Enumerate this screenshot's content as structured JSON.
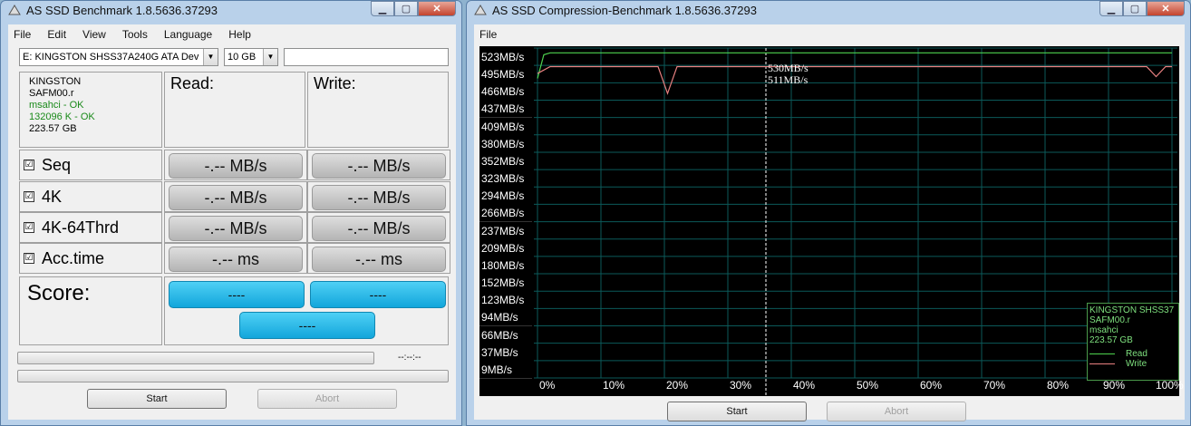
{
  "main_window": {
    "title": "AS SSD Benchmark 1.8.5636.37293",
    "menu": [
      "File",
      "Edit",
      "View",
      "Tools",
      "Language",
      "Help"
    ],
    "drive_select": "E: KINGSTON SHSS37A240G ATA Dev",
    "size_select": "10 GB",
    "drive_info": {
      "model": "KINGSTON",
      "firmware": "SAFM00.r",
      "driver": "msahci - OK",
      "alignment": "132096 K - OK",
      "capacity": "223.57 GB"
    },
    "read_header": "Read:",
    "write_header": "Write:",
    "tests": [
      {
        "name": "Seq",
        "checked": true,
        "read": "-.-- MB/s",
        "write": "-.-- MB/s"
      },
      {
        "name": "4K",
        "checked": true,
        "read": "-.-- MB/s",
        "write": "-.-- MB/s"
      },
      {
        "name": "4K-64Thrd",
        "checked": true,
        "read": "-.-- MB/s",
        "write": "-.-- MB/s"
      },
      {
        "name": "Acc.time",
        "checked": true,
        "read": "-.-- ms",
        "write": "-.-- ms"
      }
    ],
    "score_label": "Score:",
    "score_read": "----",
    "score_write": "----",
    "score_total": "----",
    "time_display": "--:--:--",
    "start_label": "Start",
    "abort_label": "Abort",
    "checkmark": "☑"
  },
  "compression_window": {
    "title": "AS SSD Compression-Benchmark 1.8.5636.37293",
    "menu": [
      "File"
    ],
    "start_label": "Start",
    "abort_label": "Abort",
    "legend": {
      "model": "KINGSTON SHSS37",
      "firmware": "SAFM00.r",
      "driver": "msahci",
      "capacity": "223.57 GB",
      "read": "Read",
      "write": "Write"
    },
    "annotations": {
      "read": "530MB/s",
      "write": "511MB/s"
    }
  },
  "colors": {
    "read": "#4ed24e",
    "write": "#e88080",
    "grid": "#0b5a5a",
    "cursor": "#ffffff"
  },
  "chart_data": {
    "type": "line",
    "y_tick_labels": [
      "523MB/s",
      "495MB/s",
      "466MB/s",
      "437MB/s",
      "409MB/s",
      "380MB/s",
      "352MB/s",
      "323MB/s",
      "294MB/s",
      "266MB/s",
      "237MB/s",
      "209MB/s",
      "180MB/s",
      "152MB/s",
      "123MB/s",
      "94MB/s",
      "66MB/s",
      "37MB/s",
      "9MB/s"
    ],
    "x_tick_labels": [
      "0%",
      "10%",
      "20%",
      "30%",
      "40%",
      "50%",
      "60%",
      "70%",
      "80%",
      "90%",
      "100%"
    ],
    "ylim": [
      9,
      523
    ],
    "xlim": [
      0,
      100
    ],
    "cursor_x": 36,
    "grid": true,
    "series": [
      {
        "name": "Read",
        "color": "#4ed24e",
        "points": [
          [
            0,
            483
          ],
          [
            1,
            521
          ],
          [
            2,
            524
          ],
          [
            10,
            524
          ],
          [
            20,
            524
          ],
          [
            30,
            524
          ],
          [
            40,
            524
          ],
          [
            50,
            524
          ],
          [
            60,
            524
          ],
          [
            70,
            524
          ],
          [
            80,
            524
          ],
          [
            90,
            524
          ],
          [
            100,
            524
          ]
        ]
      },
      {
        "name": "Write",
        "color": "#e88080",
        "points": [
          [
            0,
            491
          ],
          [
            2,
            502
          ],
          [
            10,
            502
          ],
          [
            19,
            502
          ],
          [
            20.5,
            459
          ],
          [
            22,
            502
          ],
          [
            30,
            502
          ],
          [
            40,
            502
          ],
          [
            50,
            502
          ],
          [
            60,
            502
          ],
          [
            70,
            502
          ],
          [
            80,
            502
          ],
          [
            90,
            502
          ],
          [
            96,
            502
          ],
          [
            97.5,
            486
          ],
          [
            99,
            502
          ],
          [
            100,
            502
          ]
        ]
      }
    ]
  }
}
